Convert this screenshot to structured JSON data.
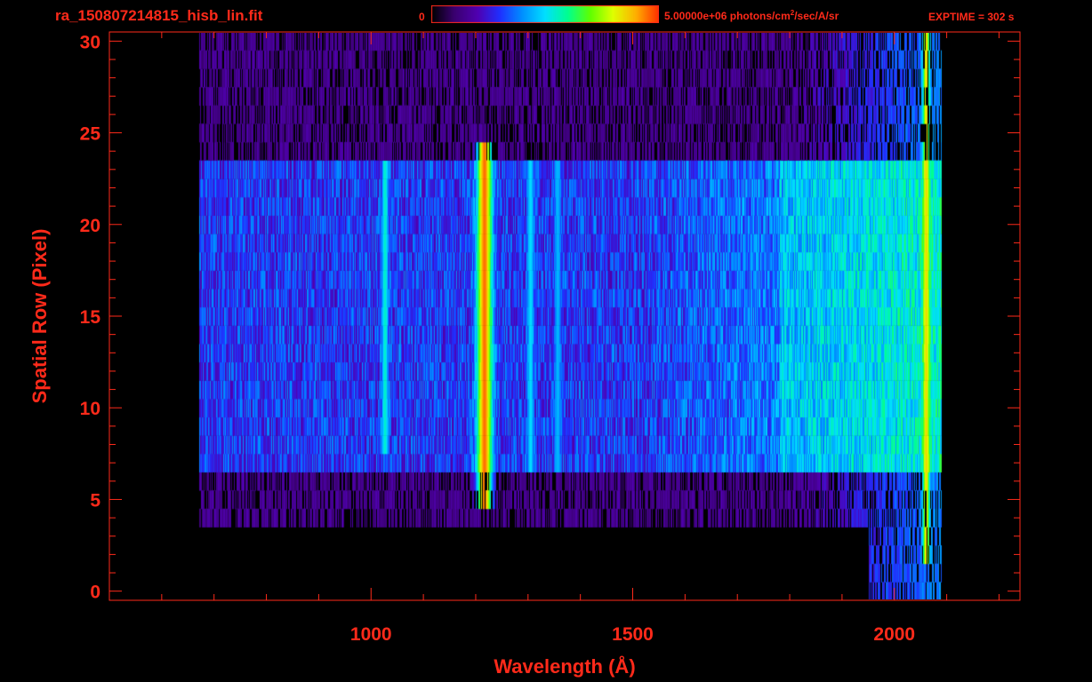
{
  "header": {
    "file_title": "ra_150807214815_hisb_lin.fit",
    "colorbar_min": "0",
    "colorbar_max_prefix": "5.00000e+06 photons/cm",
    "colorbar_max_sup": "2",
    "colorbar_max_suffix": "/sec/A/sr",
    "exptime": "EXPTIME = 302 s"
  },
  "colors": {
    "axis": "#ff2a1a",
    "background": "#000000",
    "colormap": [
      "#000000",
      "#3a0070",
      "#5000b0",
      "#2030ff",
      "#0090ff",
      "#00e0ff",
      "#00ff90",
      "#60ff00",
      "#e0ff00",
      "#ffb000",
      "#ff3000"
    ]
  },
  "chart_data": {
    "type": "heatmap",
    "title": "ra_150807214815_hisb_lin.fit",
    "xlabel": "Wavelength (Å)",
    "ylabel": "Spatial Row (Pixel)",
    "xlim": [
      500,
      2240
    ],
    "ylim": [
      -0.5,
      30.5
    ],
    "x_ticks": [
      1000,
      1500,
      2000
    ],
    "x_tick_labels": [
      "1000",
      "1500",
      "2000"
    ],
    "x_minor_ticks": [
      600,
      700,
      800,
      900,
      1100,
      1200,
      1300,
      1400,
      1600,
      1700,
      1800,
      1900,
      2100,
      2200
    ],
    "y_ticks": [
      0,
      5,
      10,
      15,
      20,
      25,
      30
    ],
    "y_tick_labels": [
      "0",
      "5",
      "10",
      "15",
      "20",
      "25",
      "30"
    ],
    "colorbar_range": [
      0,
      5000000
    ],
    "colorbar_units": "photons/cm^2/sec/A/sr",
    "wavelength_range": [
      670,
      2090
    ],
    "slit_rows": [
      7,
      23
    ],
    "features": [
      {
        "wavelength": 1216,
        "rows": [
          5,
          24
        ],
        "relative_intensity": 0.95
      },
      {
        "wavelength": 1026,
        "rows": [
          8,
          23
        ],
        "relative_intensity": 0.55
      },
      {
        "wavelength": 1304,
        "rows": [
          7,
          23
        ],
        "relative_intensity": 0.5
      },
      {
        "wavelength": 1356,
        "rows": [
          7,
          23
        ],
        "relative_intensity": 0.45
      },
      {
        "wavelength": 2060,
        "rows": [
          2,
          30
        ],
        "relative_intensity": 0.85
      }
    ],
    "grid": false
  }
}
